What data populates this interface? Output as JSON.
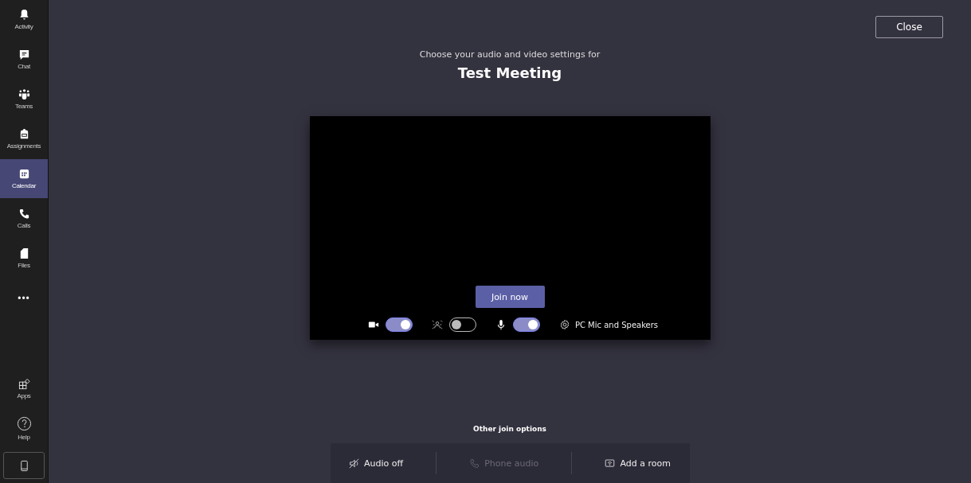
{
  "sidebar": {
    "items": [
      {
        "kind": "bell",
        "label": "Activity",
        "selected": false
      },
      {
        "kind": "chat",
        "label": "Chat",
        "selected": false
      },
      {
        "kind": "teams",
        "label": "Teams",
        "selected": false
      },
      {
        "kind": "bag",
        "label": "Assignments",
        "selected": false
      },
      {
        "kind": "calendar",
        "label": "Calendar",
        "selected": true
      },
      {
        "kind": "phone",
        "label": "Calls",
        "selected": false
      },
      {
        "kind": "file",
        "label": "Files",
        "selected": false
      },
      {
        "kind": "more",
        "label": "•••",
        "selected": false
      }
    ],
    "bottom_items": [
      {
        "kind": "apps",
        "label": "Apps"
      },
      {
        "kind": "help",
        "label": "Help"
      },
      {
        "kind": "device"
      }
    ]
  },
  "close_button": "Close",
  "subtitle": "Choose your audio and video settings for",
  "meeting_title": "Test Meeting",
  "join_button": "Join now",
  "controls": [
    {
      "kind": "camera",
      "on": true
    },
    {
      "kind": "blur",
      "on": false
    },
    {
      "kind": "mic",
      "on": true
    }
  ],
  "device_settings": "PC Mic and Speakers",
  "other_options": {
    "heading": "Other join options",
    "items": [
      {
        "kind": "audio-off",
        "label": "Audio off",
        "disabled": false
      },
      {
        "kind": "phone",
        "label": "Phone audio",
        "disabled": true
      },
      {
        "kind": "room",
        "label": "Add a room",
        "disabled": false
      }
    ]
  }
}
